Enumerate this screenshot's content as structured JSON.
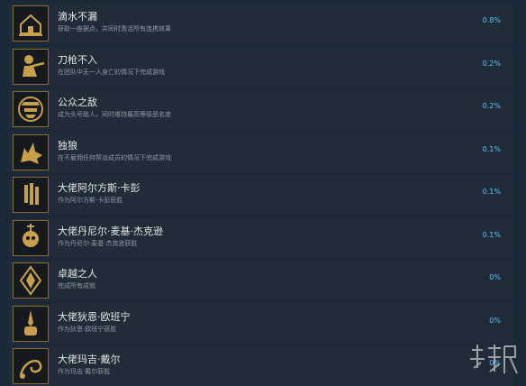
{
  "achievements": [
    {
      "title": "滴水不漏",
      "description": "获取一座据点，并同时激活所有连携效果",
      "percent": "0.8%",
      "icon": "house-hand-icon"
    },
    {
      "title": "刀枪不入",
      "description": "在团队中无一人身亡的情况下完成游戏",
      "percent": "0.2%",
      "icon": "soldier-aim-icon"
    },
    {
      "title": "公众之敌",
      "description": "成为头号敌人，同时维持最高等级恶名度",
      "percent": "0.2%",
      "icon": "masked-outlaw-icon"
    },
    {
      "title": "独狼",
      "description": "在不雇佣任何帮派成员的情况下完成游戏",
      "percent": "0.1%",
      "icon": "lone-wolf-icon"
    },
    {
      "title": "大佬阿尔方斯·卡彭",
      "description": "作为阿尔方斯·卡彭获胜",
      "percent": "0.1%",
      "icon": "bullets-icon"
    },
    {
      "title": "大佬丹尼尔·麦基·杰克逊",
      "description": "作为丹尼尔·麦基·杰克逊获胜",
      "percent": "0.1%",
      "icon": "skull-dagger-icon"
    },
    {
      "title": "卓越之人",
      "description": "完成所有成就",
      "percent": "0%",
      "icon": "emblem-icon"
    },
    {
      "title": "大佬狄恩·欧班宁",
      "description": "作为狄恩·欧班宁获胜",
      "percent": "0%",
      "icon": "dagger-fist-icon"
    },
    {
      "title": "大佬玛吉·戴尔",
      "description": "作为玛吉·戴尔获胜",
      "percent": "0%",
      "icon": "whip-icon"
    }
  ],
  "watermark": "游侠网",
  "colors": {
    "background": "#1b2838",
    "row": "#202d39",
    "title": "#e6e6e6",
    "description": "#8f98a0",
    "percent": "#66c0f4",
    "icon_gold": "#c9a04a"
  }
}
